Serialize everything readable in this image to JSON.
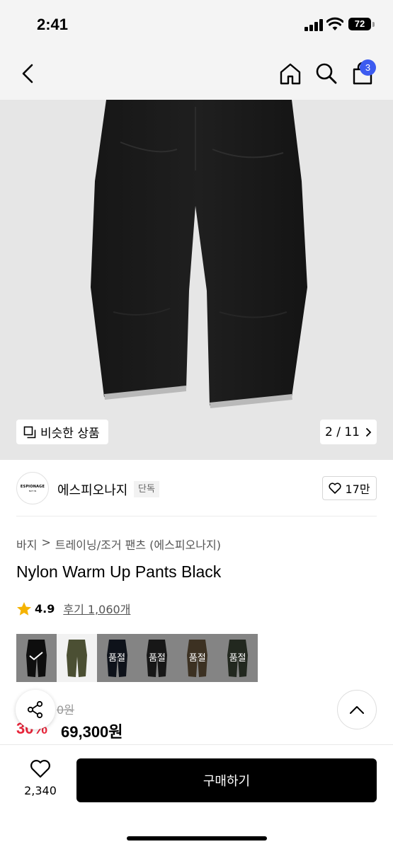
{
  "status_bar": {
    "time": "2:41",
    "battery": "72"
  },
  "nav": {
    "cart_count": "3"
  },
  "gallery": {
    "similar_label": "비슷한 상품",
    "page_indicator": "2 / 11"
  },
  "brand": {
    "logo_text_1": "ESPIONAGE",
    "logo_text_2": "NOT IN",
    "name": "에스피오나지",
    "exclusive_badge": "단독",
    "likes": "17만"
  },
  "breadcrumb": [
    "바지",
    ">",
    "트레이닝/조거 팬츠 (에스피오나지)"
  ],
  "product": {
    "title": "Nylon Warm Up Pants Black",
    "rating": "4.9",
    "reviews": "후기 1,060개",
    "original_price": "0원",
    "discount": "30%",
    "price": "69,300원"
  },
  "swatches": [
    {
      "color": "#1a1a1a",
      "bg": "#f0f0f0",
      "selected": true,
      "soldout": ""
    },
    {
      "color": "#4b4f33",
      "bg": "#f2f2f2",
      "selected": false,
      "soldout": ""
    },
    {
      "color": "#1b2130",
      "bg": "#f0f0f0",
      "selected": false,
      "soldout": "품절"
    },
    {
      "color": "#2a2a2a",
      "bg": "#f0f0f0",
      "selected": false,
      "soldout": "품절"
    },
    {
      "color": "#6e5a3e",
      "bg": "#f0f0f0",
      "selected": false,
      "soldout": "품절"
    },
    {
      "color": "#3e4a3a",
      "bg": "#f0f0f0",
      "selected": false,
      "soldout": "품절"
    }
  ],
  "bottom": {
    "wish_count": "2,340",
    "buy_label": "구매하기"
  },
  "colors": {
    "accent": "#3c5bf0",
    "discount": "#e8253a",
    "star": "#f5b301"
  }
}
